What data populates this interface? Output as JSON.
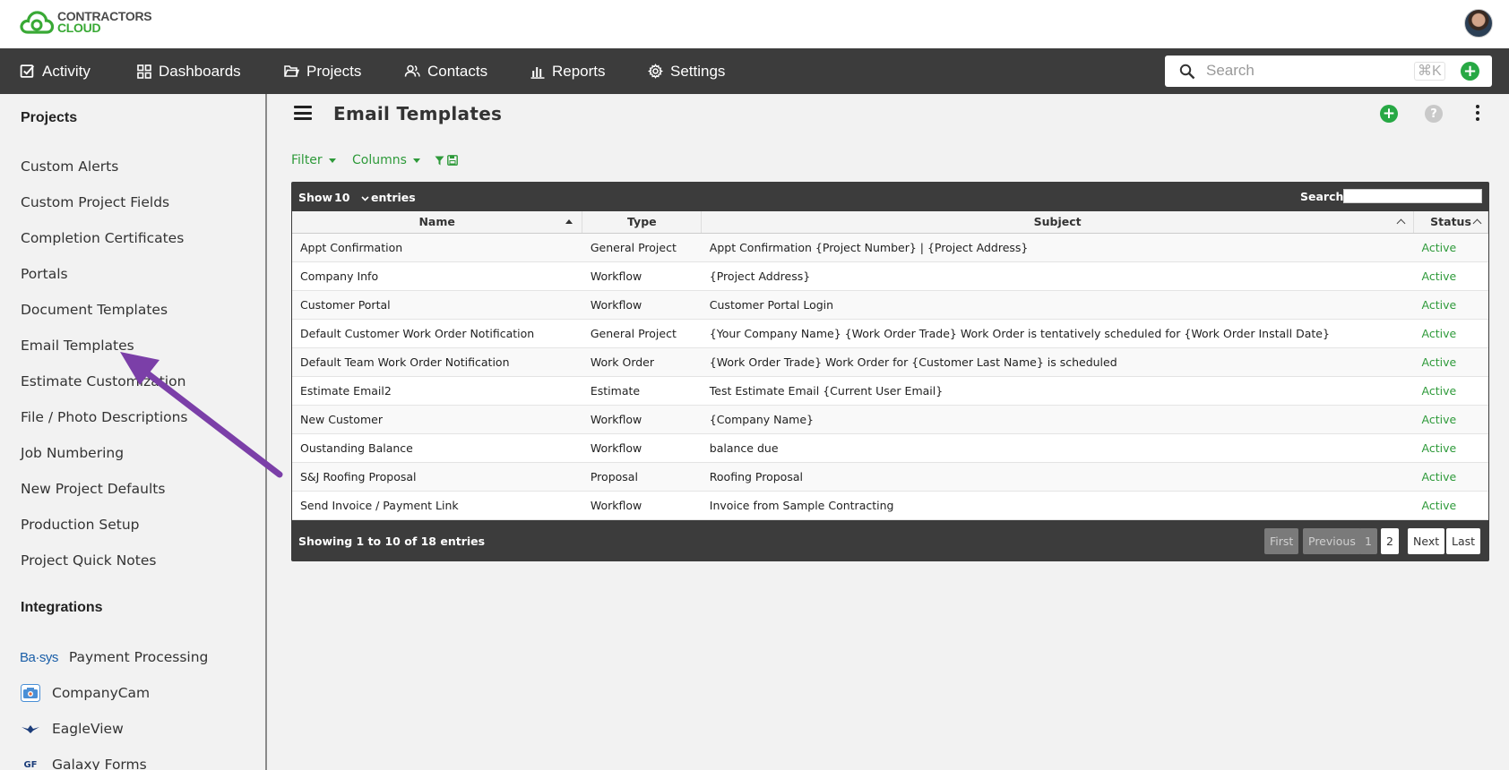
{
  "brand": {
    "line1": "CONTRACTORS",
    "line2": "CLOUD",
    "colors": {
      "green": "#39a935",
      "gray": "#4a4a4a"
    }
  },
  "nav": {
    "items": [
      {
        "label": "Activity",
        "icon": "checkbox-icon"
      },
      {
        "label": "Dashboards",
        "icon": "grid-icon"
      },
      {
        "label": "Projects",
        "icon": "folder-icon"
      },
      {
        "label": "Contacts",
        "icon": "users-icon"
      },
      {
        "label": "Reports",
        "icon": "bar-chart-icon"
      },
      {
        "label": "Settings",
        "icon": "gear-icon"
      }
    ],
    "search_placeholder": "Search",
    "shortcut": "⌘K",
    "background": "#3c3c3c"
  },
  "sidebar": {
    "projects_heading": "Projects",
    "projects_items": [
      "Custom Alerts",
      "Custom Project Fields",
      "Completion Certificates",
      "Portals",
      "Document Templates",
      "Email Templates",
      "Estimate Customization",
      "File / Photo Descriptions",
      "Job Numbering",
      "New Project Defaults",
      "Production Setup",
      "Project Quick Notes"
    ],
    "integrations_heading": "Integrations",
    "integrations_items": [
      {
        "label": "Payment Processing",
        "logo": "Ba·sys"
      },
      {
        "label": "CompanyCam",
        "logo": "camera-icon"
      },
      {
        "label": "EagleView",
        "logo": "eagle-icon"
      },
      {
        "label": "Galaxy Forms",
        "logo": "GF"
      }
    ]
  },
  "page": {
    "title": "Email Templates",
    "filter_label": "Filter",
    "columns_label": "Columns"
  },
  "table": {
    "show_label": "Show",
    "page_size": "10",
    "entries_label": "entries",
    "search_label": "Search:",
    "columns": [
      "Name",
      "Type",
      "Subject",
      "Status"
    ],
    "rows": [
      {
        "name": "Appt Confirmation",
        "type": "General Project",
        "subject": "Appt Confirmation {Project Number} | {Project Address}",
        "status": "Active"
      },
      {
        "name": "Company Info",
        "type": "Workflow",
        "subject": "{Project Address}",
        "status": "Active"
      },
      {
        "name": "Customer Portal",
        "type": "Workflow",
        "subject": "Customer Portal Login",
        "status": "Active"
      },
      {
        "name": "Default Customer Work Order Notification",
        "type": "General Project",
        "subject": "{Your Company Name} {Work Order Trade} Work Order is tentatively scheduled for {Work Order Install Date}",
        "status": "Active"
      },
      {
        "name": "Default Team Work Order Notification",
        "type": "Work Order",
        "subject": "{Work Order Trade} Work Order for {Customer Last Name} is scheduled",
        "status": "Active"
      },
      {
        "name": "Estimate Email2",
        "type": "Estimate",
        "subject": "Test Estimate Email {Current User Email}",
        "status": "Active"
      },
      {
        "name": "New Customer",
        "type": "Workflow",
        "subject": "{Company Name}",
        "status": "Active"
      },
      {
        "name": "Oustanding Balance",
        "type": "Workflow",
        "subject": "balance due",
        "status": "Active"
      },
      {
        "name": "S&J Roofing Proposal",
        "type": "Proposal",
        "subject": "Roofing Proposal",
        "status": "Active"
      },
      {
        "name": "Send Invoice / Payment Link",
        "type": "Workflow",
        "subject": "Invoice from Sample Contracting",
        "status": "Active"
      }
    ],
    "showing_text": "Showing 1 to 10 of 18 entries",
    "pagination": {
      "first": "First",
      "previous": "Previous",
      "page1": "1",
      "page2": "2",
      "next": "Next",
      "last": "Last"
    },
    "status_color": "#2e9a3a"
  },
  "annotation": {
    "arrow_color": "#7b3fa8"
  }
}
